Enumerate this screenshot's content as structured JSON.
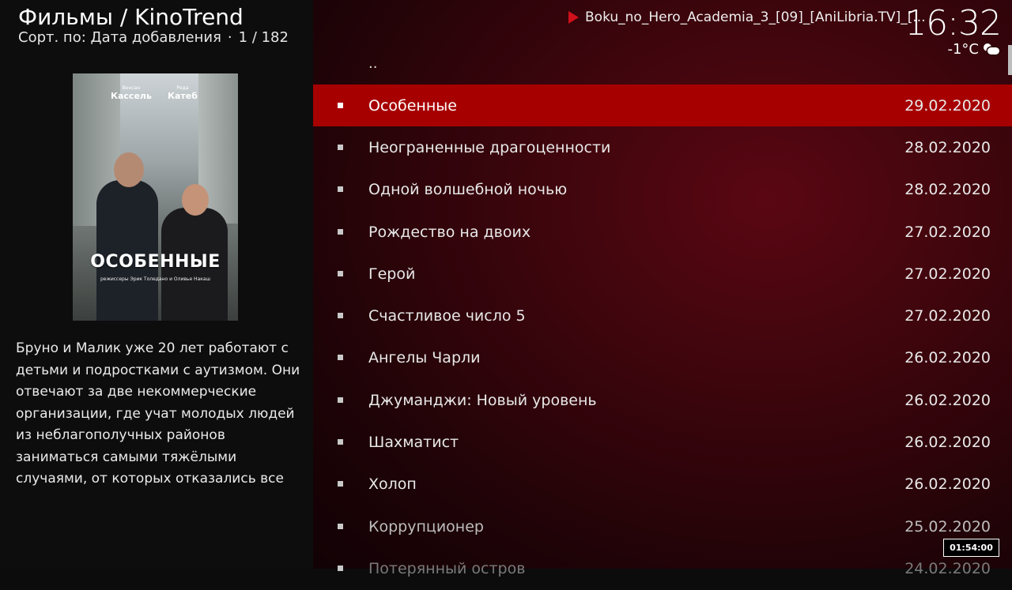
{
  "header": {
    "title": "Фильмы / KinoTrend",
    "sort_label": "Сорт. по: Дата добавления",
    "separator": "·",
    "position": "1 / 182"
  },
  "now_playing": {
    "icon": "play-icon",
    "title": "Boku_no_Hero_Academia_3_[09]_[AniLibria.TV]_[..."
  },
  "clock": {
    "time": "16:32"
  },
  "weather": {
    "temperature": "-1°C",
    "icon": "partly-cloudy-icon"
  },
  "poster": {
    "actor1_first": "Венсан",
    "actor1_last": "Кассель",
    "actor2_first": "Реда",
    "actor2_last": "Катеб",
    "title": "ОСОБЕННЫЕ",
    "credit": "режиссеры Эрик Толедано и Оливье Накаш"
  },
  "plot": "Бруно и Малик уже 20 лет работают с детьми и подростками с аутизмом. Они отвечают за две некоммерческие организации, где учат молодых людей из неблагополучных районов заниматься самыми тяжёлыми случаями, от которых отказались все",
  "list": {
    "parent": "..",
    "items": [
      {
        "title": "Особенные",
        "date": "29.02.2020"
      },
      {
        "title": "Неограненные драгоценности",
        "date": "28.02.2020"
      },
      {
        "title": "Одной волшебной ночью",
        "date": "28.02.2020"
      },
      {
        "title": "Рождество на двоих",
        "date": "27.02.2020"
      },
      {
        "title": "Герой",
        "date": "27.02.2020"
      },
      {
        "title": "Счастливое число 5",
        "date": "27.02.2020"
      },
      {
        "title": "Ангелы Чарли",
        "date": "26.02.2020"
      },
      {
        "title": "Джуманджи: Новый уровень",
        "date": "26.02.2020"
      },
      {
        "title": "Шахматист",
        "date": "26.02.2020"
      },
      {
        "title": "Холоп",
        "date": "26.02.2020"
      },
      {
        "title": "Коррупционер",
        "date": "25.02.2020"
      },
      {
        "title": "Потерянный остров",
        "date": "24.02.2020"
      }
    ],
    "selected_index": 0
  },
  "timer": "01:54:00",
  "colors": {
    "selection": "#a70000",
    "play_icon": "#d0101a",
    "background_gradient": "#3a050c"
  }
}
